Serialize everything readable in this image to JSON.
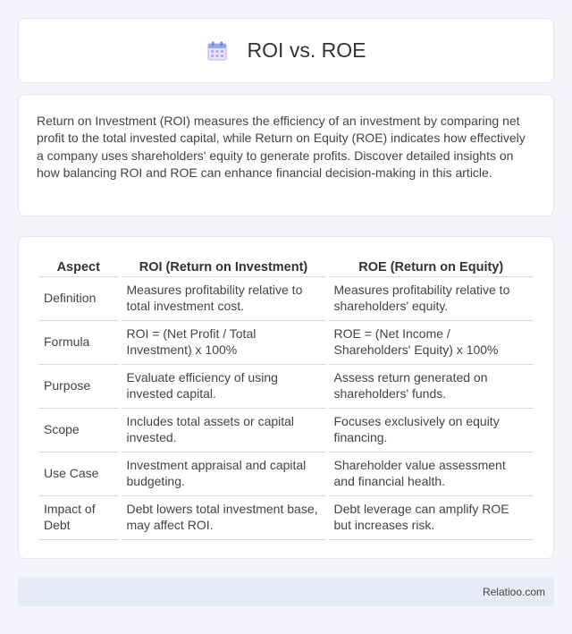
{
  "header": {
    "title": "ROI vs. ROE",
    "icon": "calendar-icon"
  },
  "intro": {
    "text": "Return on Investment (ROI) measures the efficiency of an investment by comparing net profit to the total invested capital, while Return on Equity (ROE) indicates how effectively a company uses shareholders' equity to generate profits. Discover detailed insights on how balancing ROI and ROE can enhance financial decision-making in this article."
  },
  "table": {
    "headers": [
      "Aspect",
      "ROI (Return on Investment)",
      "ROE (Return on Equity)"
    ],
    "rows": [
      [
        "Definition",
        "Measures profitability relative to total investment cost.",
        "Measures profitability relative to shareholders' equity."
      ],
      [
        "Formula",
        "ROI = (Net Profit / Total Investment) x 100%",
        "ROE = (Net Income / Shareholders' Equity) x 100%"
      ],
      [
        "Purpose",
        "Evaluate efficiency of using invested capital.",
        "Assess return generated on shareholders' funds."
      ],
      [
        "Scope",
        "Includes total assets or capital invested.",
        "Focuses exclusively on equity financing."
      ],
      [
        "Use Case",
        "Investment appraisal and capital budgeting.",
        "Shareholder value assessment and financial health."
      ],
      [
        "Impact of Debt",
        "Debt lowers total investment base, may affect ROI.",
        "Debt leverage can amplify ROE but increases risk."
      ]
    ]
  },
  "footer": {
    "brand": "Relatioo.com"
  }
}
